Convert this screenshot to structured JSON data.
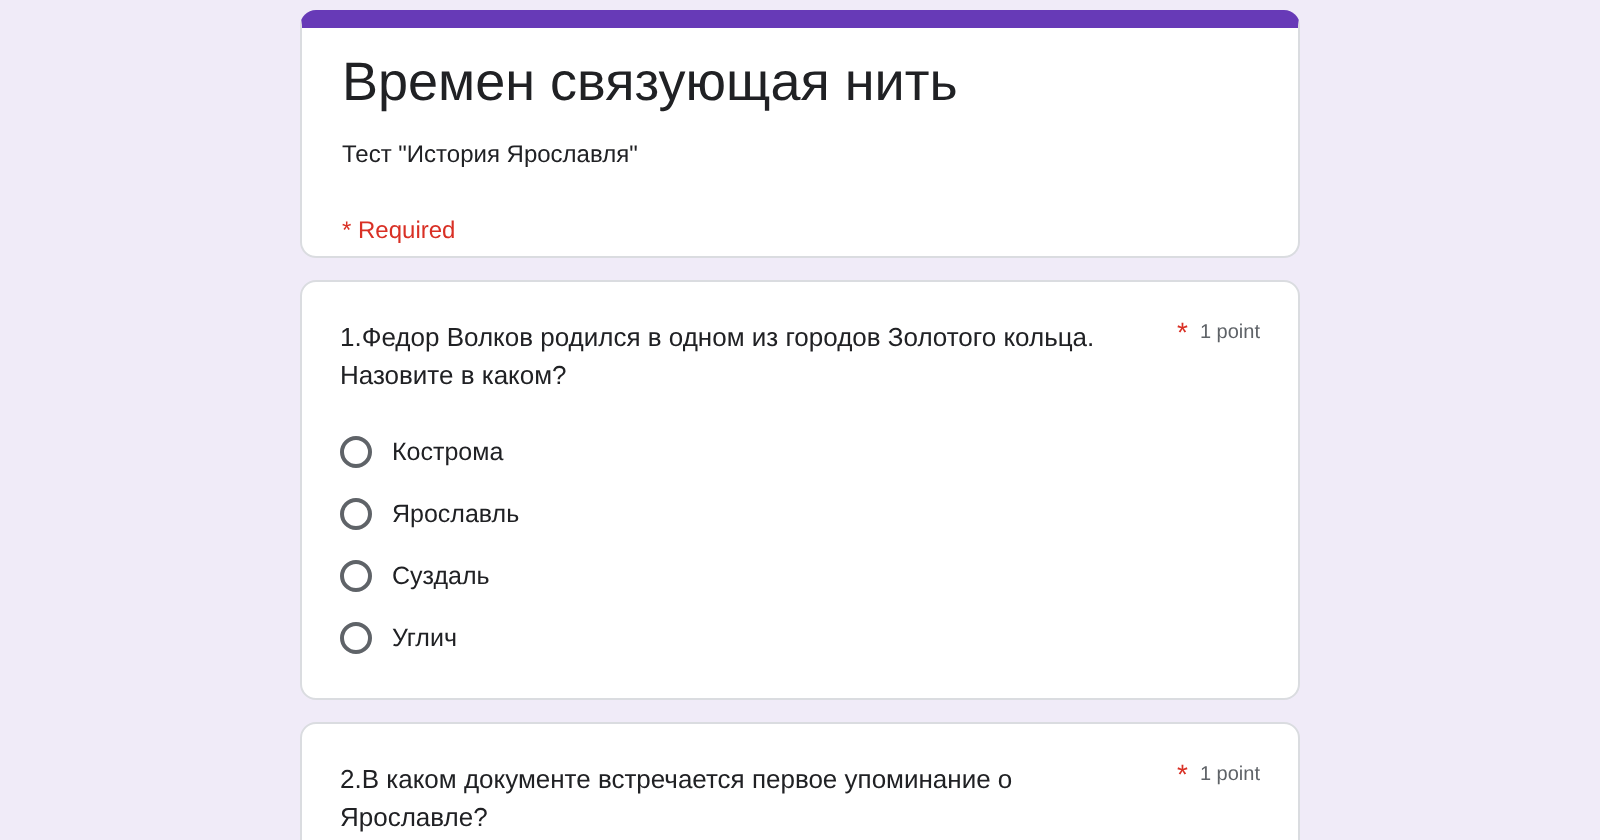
{
  "form": {
    "title": "Времен связующая нить",
    "description": "Тест \"История Ярославля\"",
    "required_note": "* Required"
  },
  "questions": [
    {
      "text": "1.Федор Волков родился в одном из городов Золотого кольца. Назовите в каком?",
      "required_mark": "*",
      "points": "1 point",
      "options": [
        {
          "label": "Кострома",
          "selected": false
        },
        {
          "label": "Ярославль",
          "selected": false
        },
        {
          "label": "Суздаль",
          "selected": false
        },
        {
          "label": "Углич",
          "selected": false
        }
      ]
    },
    {
      "text": "2.В каком документе встречается первое упоминание о Ярославле?",
      "required_mark": "*",
      "points": "1 point"
    }
  ]
}
